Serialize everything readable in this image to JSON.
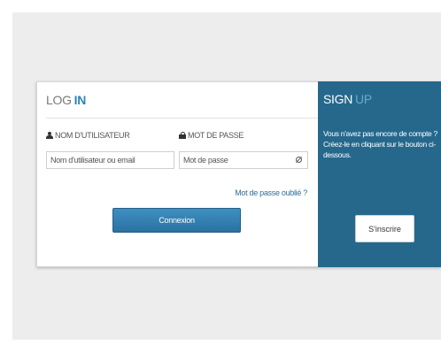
{
  "login": {
    "title_part1": "LOG",
    "title_part2": "IN",
    "username_label": "NOM D'UTILISATEUR",
    "password_label": "MOT DE PASSE",
    "username_placeholder": "Nom d'utilisateur ou email",
    "password_placeholder": "Mot de passe",
    "forgot_password": "Mot de passe oublié ?",
    "submit_label": "Connexion"
  },
  "signup": {
    "title_part1": "SIGN",
    "title_part2": "UP",
    "text_line1": "Vous n'avez pas encore de compte ?",
    "text_line2": "Créez-le en cliquant sur le bouton ci-dessous.",
    "button_label": "S'inscrire"
  },
  "colors": {
    "accent": "#2e84b5",
    "signup_bg": "#26688c",
    "button_bg": "#2f7db0"
  }
}
